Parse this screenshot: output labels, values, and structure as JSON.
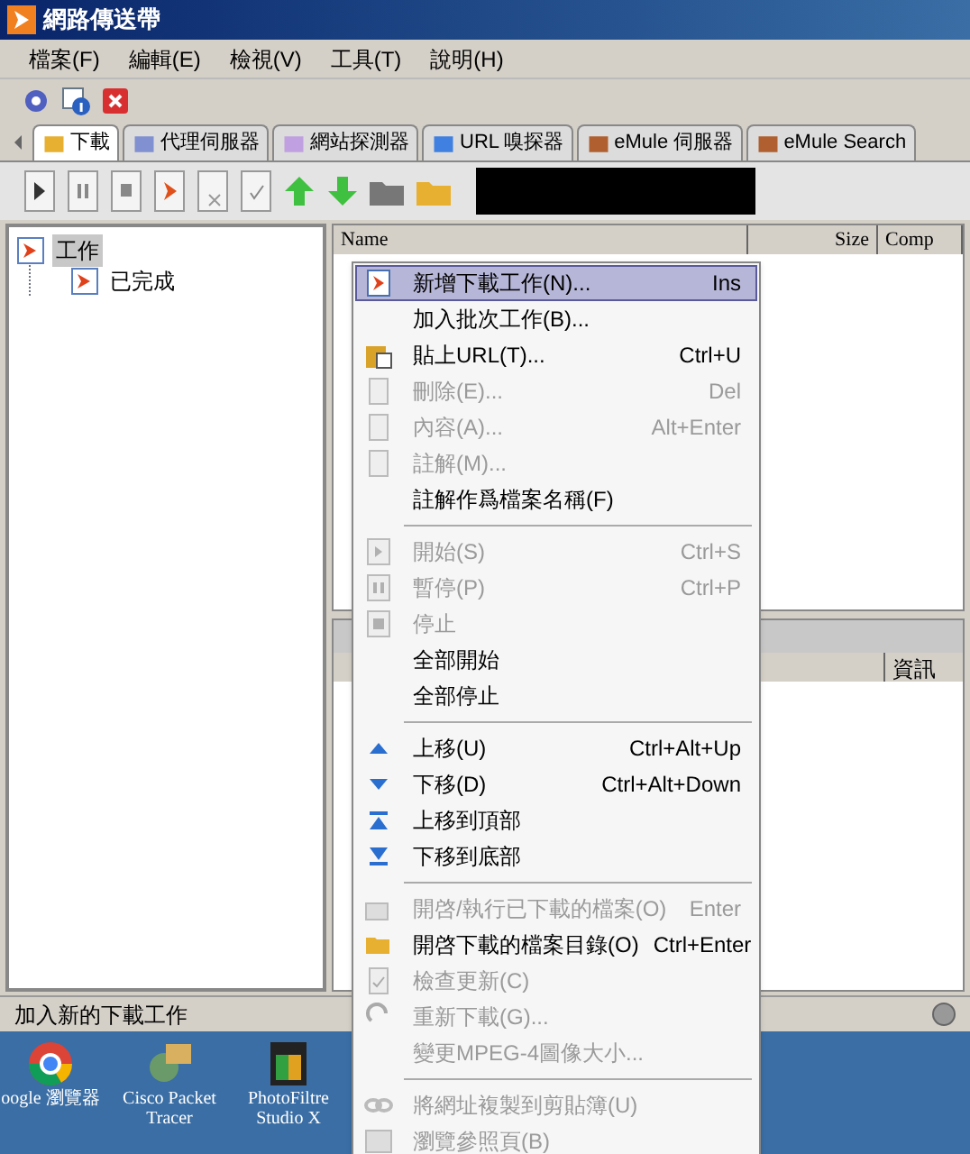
{
  "window": {
    "title": "網路傳送帶"
  },
  "menu_bar": [
    "檔案(F)",
    "編輯(E)",
    "檢視(V)",
    "工具(T)",
    "說明(H)"
  ],
  "tabs": [
    {
      "label": "下載",
      "selected": true
    },
    {
      "label": "代理伺服器",
      "selected": false
    },
    {
      "label": "網站探測器",
      "selected": false
    },
    {
      "label": "URL 嗅探器",
      "selected": false
    },
    {
      "label": "eMule 伺服器",
      "selected": false
    },
    {
      "label": "eMule Search",
      "selected": false
    }
  ],
  "tree": [
    {
      "label": "工作",
      "selected": true,
      "children": [
        {
          "label": "已完成",
          "selected": false
        }
      ]
    }
  ],
  "list_columns": [
    "Name",
    "Size",
    "Comp"
  ],
  "detail_columns": [
    "資訊"
  ],
  "status_bar": "加入新的下載工作",
  "context_menu": [
    {
      "kind": "item",
      "label": "新增下載工作(N)...",
      "shortcut": "Ins",
      "disabled": false,
      "selected": true
    },
    {
      "kind": "item",
      "label": "加入批次工作(B)...",
      "disabled": false,
      "selected": false
    },
    {
      "kind": "item",
      "label": "貼上URL(T)...",
      "shortcut": "Ctrl+U",
      "disabled": false,
      "selected": false
    },
    {
      "kind": "item",
      "label": "刪除(E)...",
      "shortcut": "Del",
      "disabled": true,
      "selected": false
    },
    {
      "kind": "item",
      "label": "內容(A)...",
      "shortcut": "Alt+Enter",
      "disabled": true,
      "selected": false
    },
    {
      "kind": "item",
      "label": "註解(M)...",
      "disabled": true,
      "selected": false
    },
    {
      "kind": "item",
      "label": "註解作爲檔案名稱(F)",
      "disabled": false,
      "selected": false
    },
    {
      "kind": "separator"
    },
    {
      "kind": "item",
      "label": "開始(S)",
      "shortcut": "Ctrl+S",
      "disabled": true,
      "selected": false
    },
    {
      "kind": "item",
      "label": "暫停(P)",
      "shortcut": "Ctrl+P",
      "disabled": true,
      "selected": false
    },
    {
      "kind": "item",
      "label": "停止",
      "disabled": true,
      "selected": false
    },
    {
      "kind": "item",
      "label": "全部開始",
      "disabled": false,
      "selected": false
    },
    {
      "kind": "item",
      "label": "全部停止",
      "disabled": false,
      "selected": false
    },
    {
      "kind": "separator"
    },
    {
      "kind": "item",
      "label": "上移(U)",
      "shortcut": "Ctrl+Alt+Up",
      "disabled": false,
      "selected": false
    },
    {
      "kind": "item",
      "label": "下移(D)",
      "shortcut": "Ctrl+Alt+Down",
      "disabled": false,
      "selected": false
    },
    {
      "kind": "item",
      "label": "上移到頂部",
      "disabled": false,
      "selected": false
    },
    {
      "kind": "item",
      "label": "下移到底部",
      "disabled": false,
      "selected": false
    },
    {
      "kind": "separator"
    },
    {
      "kind": "item",
      "label": "開啓/執行已下載的檔案(O)",
      "shortcut": "Enter",
      "disabled": true,
      "selected": false
    },
    {
      "kind": "item",
      "label": "開啓下載的檔案目錄(O)",
      "shortcut": "Ctrl+Enter",
      "disabled": false,
      "selected": false
    },
    {
      "kind": "item",
      "label": "檢查更新(C)",
      "disabled": true,
      "selected": false
    },
    {
      "kind": "item",
      "label": "重新下載(G)...",
      "disabled": true,
      "selected": false
    },
    {
      "kind": "item",
      "label": "變更MPEG-4圖像大小...",
      "disabled": true,
      "selected": false
    },
    {
      "kind": "separator"
    },
    {
      "kind": "item",
      "label": "將網址複製到剪貼簿(U)",
      "disabled": true,
      "selected": false
    },
    {
      "kind": "item",
      "label": "瀏覽參照頁(B)",
      "disabled": true,
      "selected": false
    }
  ],
  "desktop_icons": [
    {
      "label": "oogle 瀏覽器"
    },
    {
      "label": "Cisco Packet Tracer"
    },
    {
      "label": "PhotoFiltre Studio X"
    }
  ]
}
